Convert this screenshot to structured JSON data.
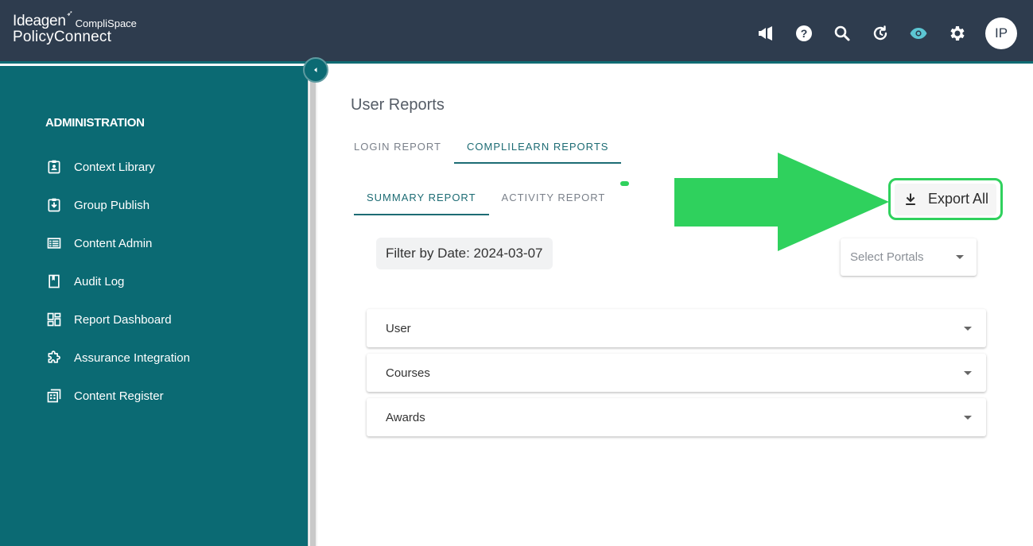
{
  "header": {
    "brand": "Ideagen",
    "brand_sub": "CompliSpace",
    "product": "PolicyConnect",
    "icons": [
      "megaphone-icon",
      "help-icon",
      "search-icon",
      "history-icon",
      "eye-icon",
      "gear-icon"
    ],
    "avatar_initials": "IP"
  },
  "sidebar": {
    "heading": "ADMINISTRATION",
    "items": [
      {
        "label": "Context Library",
        "icon": "contact-card-icon"
      },
      {
        "label": "Group Publish",
        "icon": "download-box-icon"
      },
      {
        "label": "Content Admin",
        "icon": "list-icon"
      },
      {
        "label": "Audit Log",
        "icon": "bookmark-icon"
      },
      {
        "label": "Report Dashboard",
        "icon": "dashboard-icon"
      },
      {
        "label": "Assurance Integration",
        "icon": "puzzle-icon"
      },
      {
        "label": "Content Register",
        "icon": "register-icon"
      }
    ]
  },
  "main": {
    "title": "User Reports",
    "tabs": [
      {
        "label": "LOGIN REPORT",
        "active": false
      },
      {
        "label": "COMPLILEARN REPORTS",
        "active": true
      }
    ],
    "subtabs": [
      {
        "label": "SUMMARY REPORT",
        "active": true
      },
      {
        "label": "ACTIVITY REPORT",
        "active": false
      }
    ],
    "export_label": "Export All",
    "filter_label": "Filter by Date: 2024-03-07",
    "portal_placeholder": "Select Portals",
    "panels": [
      "User",
      "Courses",
      "Awards"
    ]
  },
  "colors": {
    "topbar": "#2e3c4e",
    "sidebar": "#0b6a73",
    "accent": "#1d6c74",
    "highlight": "#2fd15d"
  }
}
